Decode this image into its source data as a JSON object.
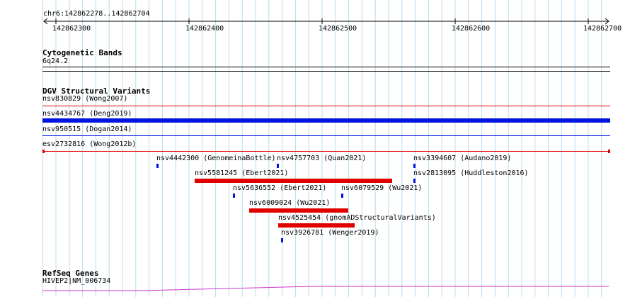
{
  "ruler": {
    "locus": "chr6:142862278..142862704",
    "ticks": [
      "142862300",
      "142862400",
      "142862500",
      "142862600",
      "142862700"
    ]
  },
  "tracks": {
    "cytogenetic": {
      "title": "Cytogenetic Bands",
      "band": "6q24.2"
    },
    "dgv": {
      "title": "DGV Structural Variants",
      "features": [
        {
          "label": "nsv830829 (Wong2007)",
          "color": "#e00000"
        },
        {
          "label": "nsv4434767 (Deng2019)",
          "color": "#0014e0"
        },
        {
          "label": "nsv950515 (Dogan2014)",
          "color": "#0014e0"
        },
        {
          "label": "esv2732816 (Wong2012b)",
          "color": "#e00000"
        },
        {
          "label": "nsv4442300 (GenomeinaBottle)",
          "color": "#0014e0"
        },
        {
          "label": "nsv4757703 (Quan2021)",
          "color": "#0014e0"
        },
        {
          "label": "nsv3394607 (Audano2019)",
          "color": "#0014e0"
        },
        {
          "label": "nsv5581245 (Ebert2021)",
          "color": "#e00000"
        },
        {
          "label": "nsv2813095 (Huddleston2016)",
          "color": "#0014e0"
        },
        {
          "label": "nsv5636552 (Ebert2021)",
          "color": "#0014e0"
        },
        {
          "label": "nsv6079529 (Wu2021)",
          "color": "#0014e0"
        },
        {
          "label": "nsv6009024 (Wu2021)",
          "color": "#e00000"
        },
        {
          "label": "nsv4525454 (gnomADStructuralVariants)",
          "color": "#e00000"
        },
        {
          "label": "nsv3926781 (Wenger2019)",
          "color": "#0014e0"
        }
      ]
    },
    "refseq": {
      "title": "RefSeq Genes",
      "gene": "HIVEP2|NM_006734",
      "color": "#cc33cc"
    }
  }
}
